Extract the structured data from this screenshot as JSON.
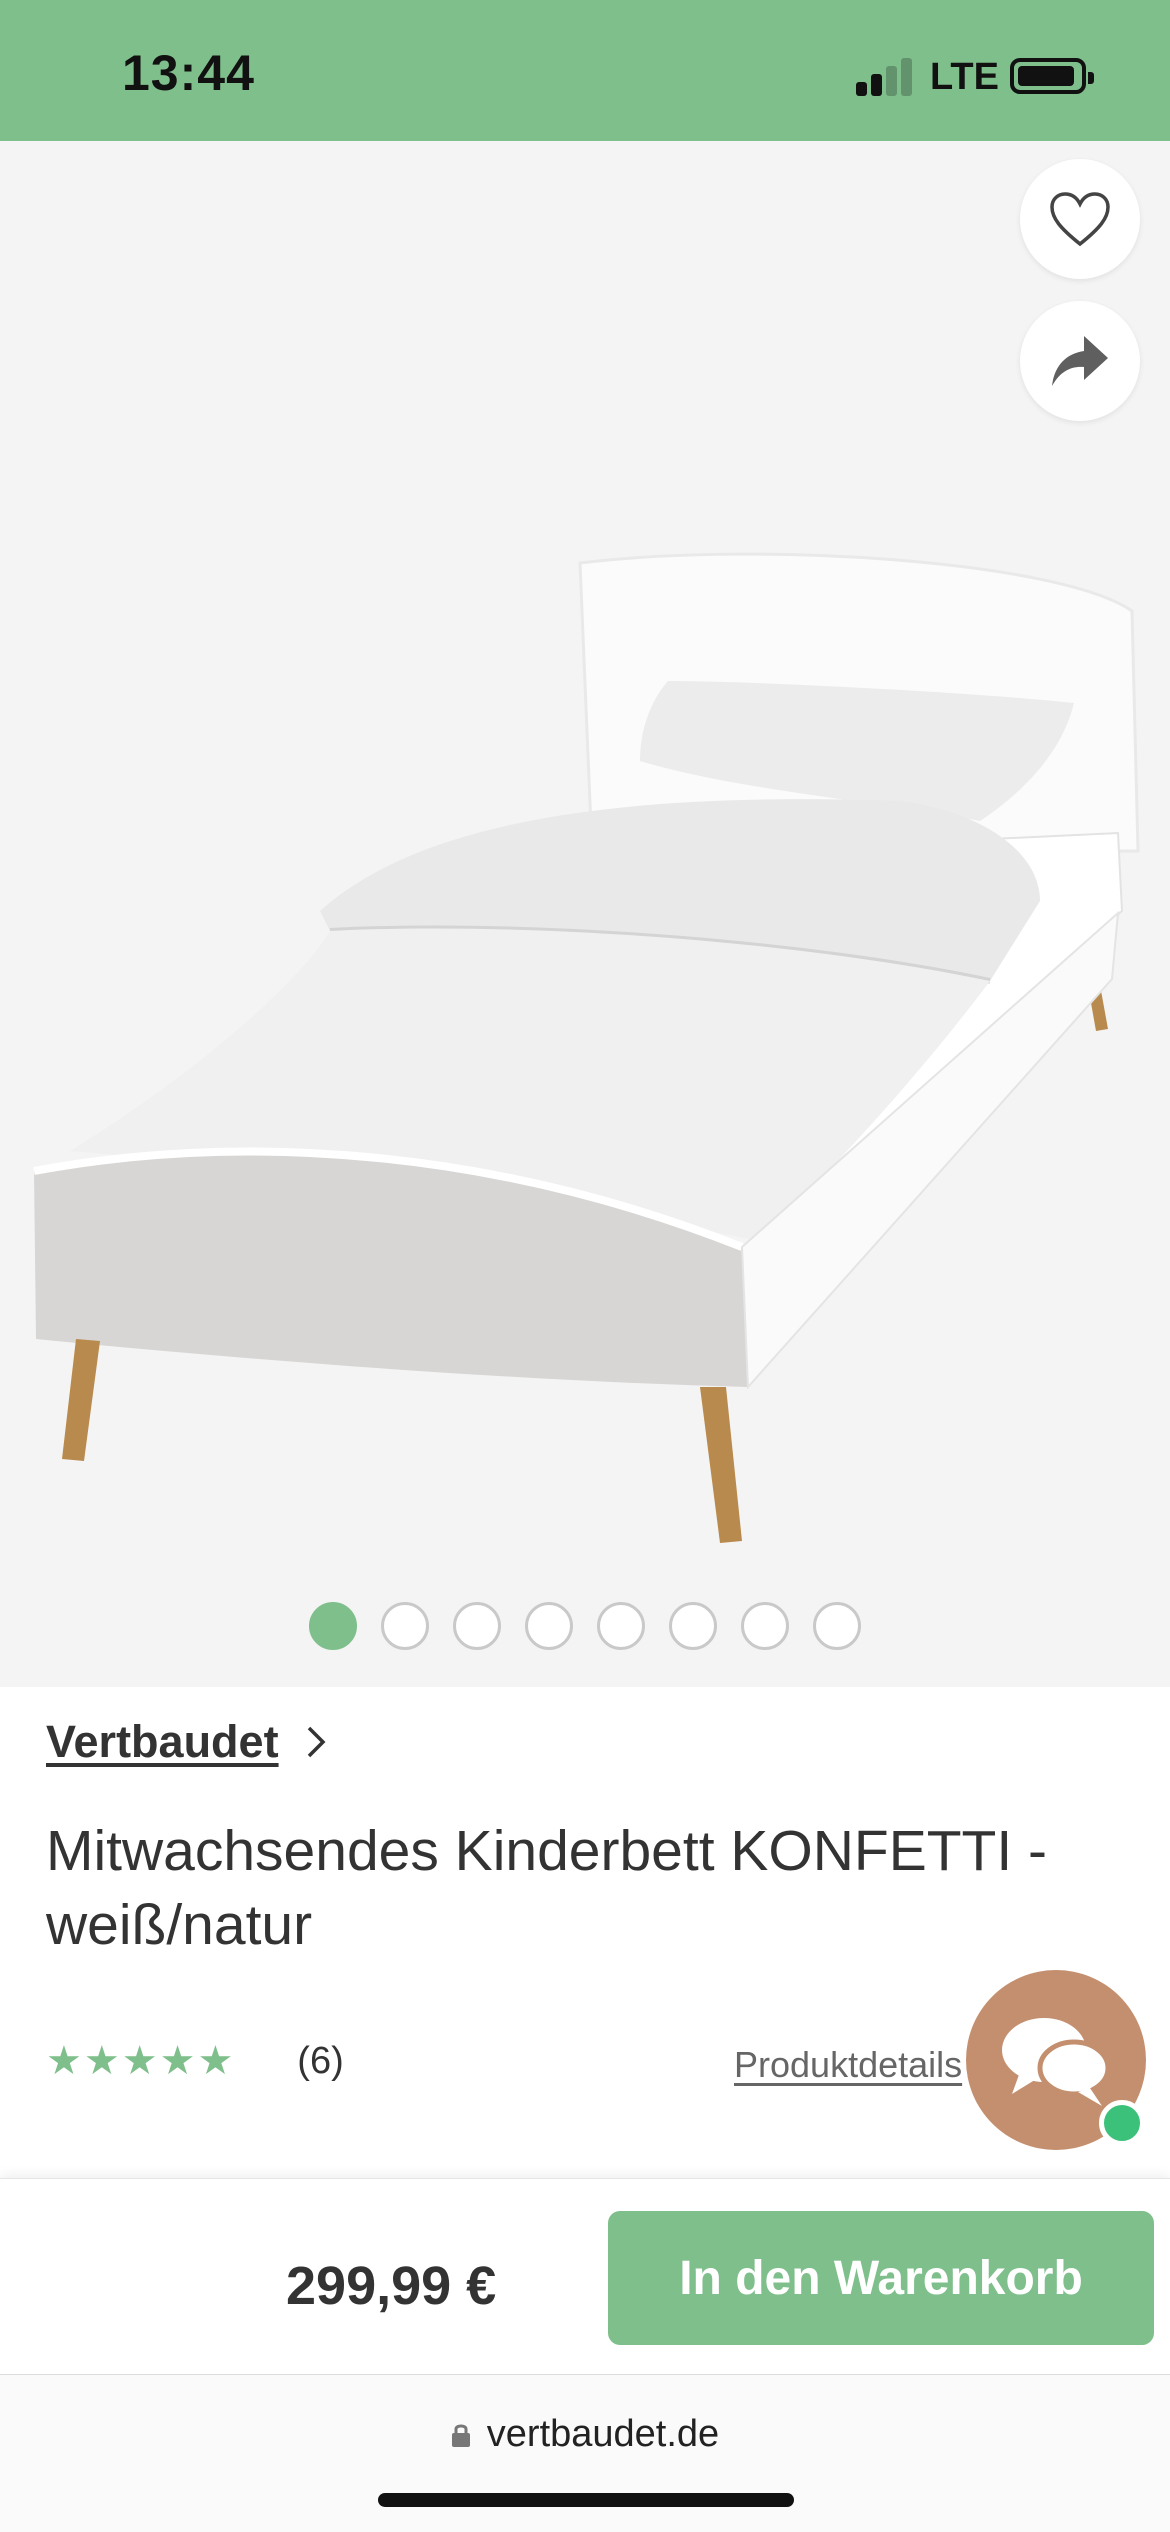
{
  "status_bar": {
    "time": "13:44",
    "network": "LTE",
    "background_color": "#7fbf8c"
  },
  "gallery": {
    "favorite_icon": "heart-outline-icon",
    "share_icon": "share-arrow-icon",
    "image_count": 8,
    "active_index": 0
  },
  "product": {
    "brand": "Vertbaudet",
    "title": "Mitwachsendes Kinderbett KONFETTI - weiß/natur",
    "stars": "★★★★★",
    "rating_value": 5,
    "review_count": "(6)",
    "details_link": "Produktdetails"
  },
  "chat": {
    "icon": "chat-bubbles-icon",
    "status": "online"
  },
  "purchase": {
    "price": "299,99 €",
    "cart_button": "In den Warenkorb"
  },
  "browser": {
    "url": "vertbaudet.de"
  },
  "colors": {
    "accent_green": "#7fbf8c",
    "chat_brown": "#c48f6f",
    "online_green": "#3cc17b"
  }
}
